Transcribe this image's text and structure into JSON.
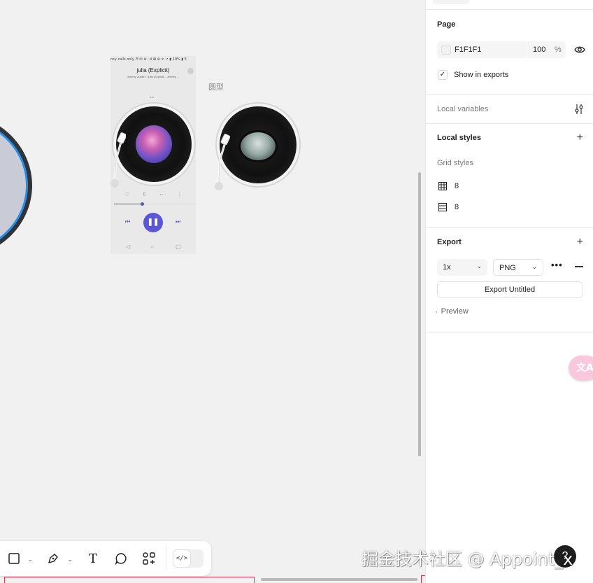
{
  "canvas": {
    "frame_label": "圆型",
    "phone": {
      "status_text": "ncy calls only ♬ ✉ ⊕ · ⑆ ⊠ ⊛ ᯤ ↗ ▮ 19% ▮ 5",
      "song_title": "julia (Explicit)",
      "song_subtitle": "Jeremy Zucker - julia (Explicit) - Jeremy ...",
      "controls": [
        "♡",
        "⇩",
        "⋯",
        "⋮"
      ],
      "progress": 0.34,
      "prev_glyph": "⏮",
      "play_glyph": "❚❚",
      "next_glyph": "⏭",
      "nav": [
        "◁",
        "○",
        "▢"
      ]
    }
  },
  "toolbar": {
    "tools": [
      "frame-tool",
      "pen-tool",
      "text-tool",
      "comment-tool",
      "components-tool"
    ],
    "text_glyph": "T",
    "dev_mode_glyph": "</>"
  },
  "watermark": "掘金技术社区 @ Appoint_x",
  "help_label": "?",
  "panel": {
    "page": {
      "title": "Page",
      "color_hex": "F1F1F1",
      "opacity": "100",
      "opacity_unit": "%",
      "show_in_exports_label": "Show in exports",
      "show_in_exports_checked": true
    },
    "local_variables": {
      "title": "Local variables"
    },
    "local_styles": {
      "title": "Local styles",
      "grid_styles_label": "Grid styles",
      "grid_items": [
        {
          "label": "8",
          "icon": "grid-icon"
        },
        {
          "label": "8",
          "icon": "rows-icon"
        }
      ]
    },
    "export": {
      "title": "Export",
      "scale": "1x",
      "format": "PNG",
      "more_glyph": "•••",
      "button_label": "Export Untitled",
      "preview_label": "Preview"
    }
  },
  "colors": {
    "canvas_bg": "#f1f1f1",
    "accent_purple": "#5b55d8",
    "selection_red": "#e0324c",
    "disc_blue": "#2a8ee8"
  }
}
